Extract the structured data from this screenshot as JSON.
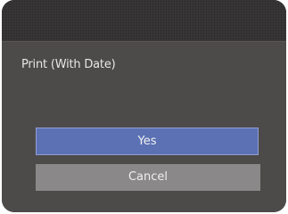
{
  "dialog": {
    "prompt": "Print (With Date)",
    "options": [
      {
        "label": "Yes",
        "selected": true
      },
      {
        "label": "Cancel",
        "selected": false
      }
    ]
  },
  "colors": {
    "panel_background": "#4d4a4a",
    "title_bar": "#3a3838",
    "selected_button": "#5b71b3",
    "unselected_button": "#8a8888",
    "text": "#f2f2f2"
  }
}
